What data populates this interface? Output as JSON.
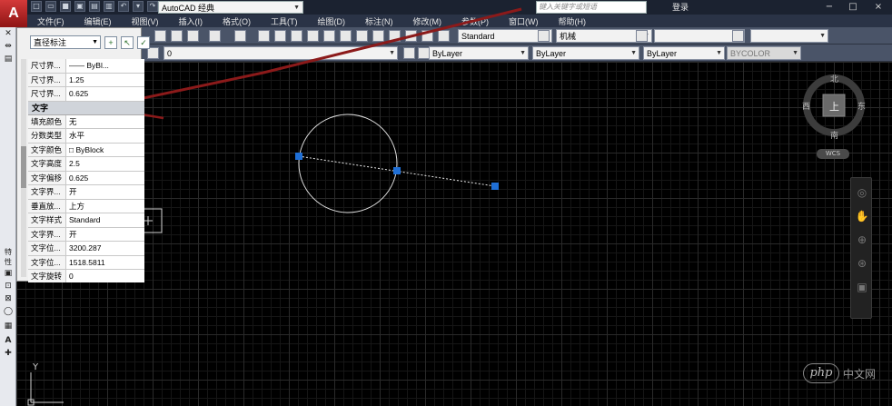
{
  "title_bar": {
    "workspace": "AutoCAD 经典",
    "search_placeholder": "键入关键字或短语",
    "login": "登录",
    "window_controls": [
      "−",
      "□",
      "×"
    ]
  },
  "menu": [
    "文件(F)",
    "编辑(E)",
    "视图(V)",
    "插入(I)",
    "格式(O)",
    "工具(T)",
    "绘图(D)",
    "标注(N)",
    "修改(M)",
    "参数(P)",
    "窗口(W)",
    "帮助(H)"
  ],
  "toolbar": {
    "text_style": "Standard",
    "dim_style": "机械",
    "layer": "0",
    "color": "ByLayer",
    "linetype": "ByLayer",
    "lineweight": "ByLayer",
    "plot_style": "BYCOLOR"
  },
  "properties": {
    "object_type": "直径标注",
    "rows_top": [
      {
        "name": "尺寸界...",
        "value": "—— ByBl..."
      },
      {
        "name": "尺寸界...",
        "value": "1.25"
      },
      {
        "name": "尺寸界...",
        "value": "0.625"
      }
    ],
    "section_text": "文字",
    "rows_text": [
      {
        "name": "填充颜色",
        "value": "无"
      },
      {
        "name": "分数类型",
        "value": "水平"
      },
      {
        "name": "文字颜色",
        "value": "□ ByBlock"
      },
      {
        "name": "文字高度",
        "value": "2.5"
      },
      {
        "name": "文字偏移",
        "value": "0.625"
      },
      {
        "name": "文字界...",
        "value": "开"
      },
      {
        "name": "垂直放...",
        "value": "上方"
      },
      {
        "name": "文字样式",
        "value": "Standard"
      },
      {
        "name": "文字界...",
        "value": "开"
      },
      {
        "name": "文字位...",
        "value": "3200.287"
      },
      {
        "name": "文字位...",
        "value": "1518.5811"
      },
      {
        "name": "文字旋转",
        "value": "0"
      }
    ],
    "palette_label": "特性"
  },
  "viewcube": {
    "north": "北",
    "south": "南",
    "east": "东",
    "west": "西",
    "top": "上",
    "wcs": "WCS"
  },
  "ucs": {
    "y": "Y"
  },
  "watermark": {
    "logo": "php",
    "text": "中文网"
  },
  "colors": {
    "canvas": "#000000",
    "grid_major": "#2a2a2a",
    "grip": "#1f6fd6",
    "arrow": "#8b1a1a",
    "circle": "#e0e0e0"
  }
}
